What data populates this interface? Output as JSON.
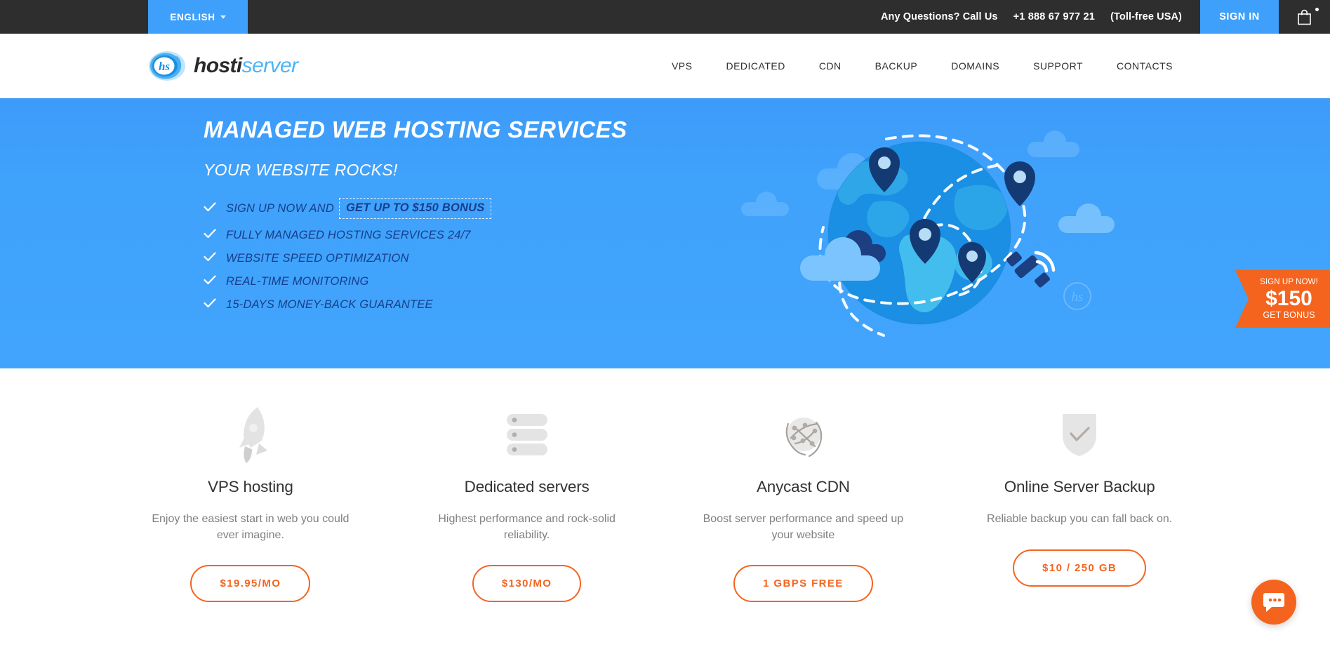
{
  "topbar": {
    "language": "ENGLISH",
    "language_icon": "chevron-down-icon",
    "call_label": "Any Questions? Call Us",
    "phone": "+1 888 67 977 21",
    "tollfree": "(Toll-free USA)",
    "signin": "SIGN IN",
    "cart_icon": "shopping-bag-icon",
    "bg_color": "#2e2e2e",
    "accent_color": "#3fa0fb"
  },
  "header": {
    "logo_primary": "hosti",
    "logo_secondary": "server",
    "logo_mark": "hs",
    "nav": [
      {
        "label": "VPS"
      },
      {
        "label": "DEDICATED"
      },
      {
        "label": "CDN"
      },
      {
        "label": "BACKUP"
      },
      {
        "label": "DOMAINS"
      },
      {
        "label": "SUPPORT"
      },
      {
        "label": "CONTACTS"
      }
    ]
  },
  "hero": {
    "bg_color": "#3fa0fb",
    "title": "MANAGED WEB HOSTING SERVICES",
    "subtitle": "YOUR WEBSITE ROCKS!",
    "bullets": [
      {
        "text": "SIGN UP NOW AND",
        "highlight": "GET UP TO $150 BONUS"
      },
      {
        "text": "FULLY MANAGED HOSTING SERVICES 24/7",
        "highlight": ""
      },
      {
        "text": "WEBSITE SPEED OPTIMIZATION",
        "highlight": ""
      },
      {
        "text": "REAL-TIME MONITORING",
        "highlight": ""
      },
      {
        "text": "15-DAYS MONEY-BACK GUARANTEE",
        "highlight": ""
      }
    ],
    "illustration": "world-globe-with-location-pins-clouds-and-satellite",
    "watermark": "hs",
    "ribbon": {
      "line1": "SIGN UP NOW!",
      "amount": "$150",
      "line3": "GET BONUS",
      "color": "#f4641e"
    }
  },
  "services": {
    "accent_color": "#f4641e",
    "cards": [
      {
        "icon": "rocket-icon",
        "title": "VPS hosting",
        "desc": "Enjoy the easiest start in web you could ever imagine.",
        "price": "$19.95/MO"
      },
      {
        "icon": "server-rack-icon",
        "title": "Dedicated servers",
        "desc": "Highest performance and rock-solid reliability.",
        "price": "$130/MO"
      },
      {
        "icon": "network-globe-icon",
        "title": "Anycast CDN",
        "desc": "Boost server performance and speed up your website",
        "price": "1 GBPS FREE"
      },
      {
        "icon": "shield-check-icon",
        "title": "Online Server Backup",
        "desc": "Reliable backup you can fall back on.",
        "price": "$10 / 250 GB"
      }
    ]
  },
  "chat": {
    "icon": "chat-bubble-icon",
    "color": "#f4641e"
  }
}
